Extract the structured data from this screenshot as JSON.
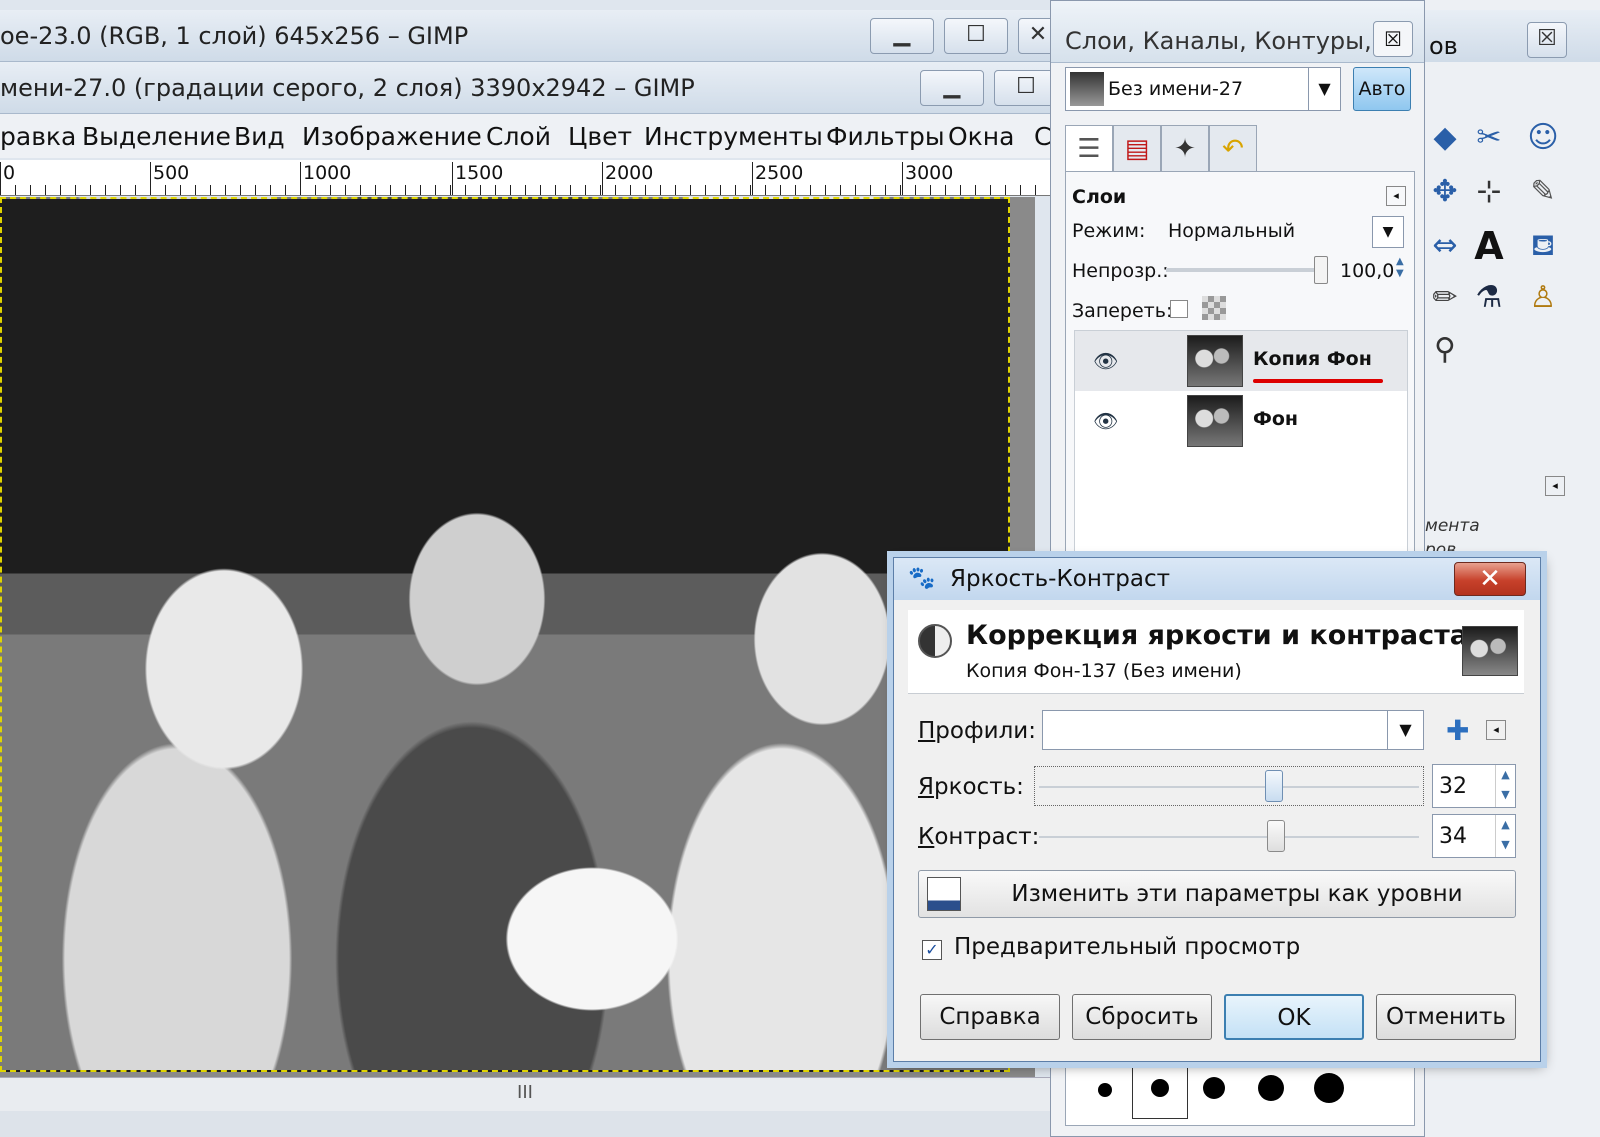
{
  "window_back": {
    "title": "ое-23.0 (RGB, 1 слой) 645x256 – GIMP"
  },
  "window_main": {
    "title": "мени-27.0 (градации серого, 2 слоя) 3390x2942 – GIMP",
    "menu": [
      "равка",
      "Выделение",
      "Вид",
      "Изображение",
      "Слой",
      "Цвет",
      "Инструменты",
      "Фильтры",
      "Окна",
      "Сп"
    ],
    "ruler": [
      "0",
      "500",
      "1000",
      "1500",
      "2000",
      "2500",
      "3000"
    ],
    "scroll_grip": "III"
  },
  "toolbox": {
    "title": "ов",
    "text_line1": "мента",
    "text_line2": "ров."
  },
  "layers_dock": {
    "title": "Слои, Каналы, Контуры, ...",
    "close": "☒",
    "image_name": "Без имени-27",
    "auto_label": "Авто",
    "panel_title": "Слои",
    "mode_label": "Режим:",
    "mode_value": "Нормальный",
    "opacity_label": "Непрозр.:",
    "opacity_value": "100,0",
    "lock_label": "Запереть:",
    "layers": [
      {
        "name": "Копия Фон",
        "selected": true
      },
      {
        "name": "Фон",
        "selected": false
      }
    ]
  },
  "dialog": {
    "title": "Яркость-Контраст",
    "close": "✕",
    "heading": "Коррекция яркости и контраста",
    "subheading": "Копия Фон-137 (Без имени)",
    "profiles_label": "Профили:",
    "profiles_value": "",
    "brightness_label": "Яркость:",
    "brightness_value": "32",
    "contrast_label": "Контраст:",
    "contrast_value": "34",
    "levels_button": "Изменить эти параметры как уровни",
    "preview_label": "Предварительный просмотр",
    "preview_checked": true,
    "buttons": {
      "help": "Справка",
      "reset": "Сбросить",
      "ok": "OK",
      "cancel": "Отменить"
    }
  }
}
